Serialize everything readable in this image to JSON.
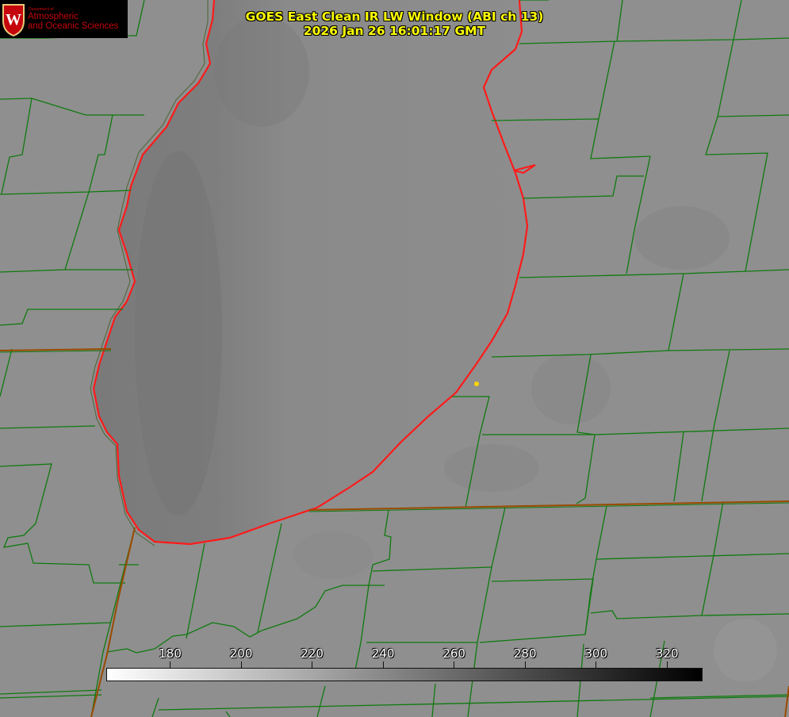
{
  "header": {
    "title_line1": "GOES East Clean IR LW Window (ABI ch 13)",
    "title_line2": "2026 Jan 26 16:01:17 GMT"
  },
  "logo": {
    "dept_label": "Department of",
    "line1": "Atmospheric",
    "line2": "and Oceanic Sciences",
    "crest_letter": "W",
    "icon": "university-crest-icon"
  },
  "colorbar": {
    "ticks": [
      180,
      200,
      220,
      240,
      260,
      280,
      300,
      320
    ],
    "range": [
      162,
      330
    ],
    "gradient_from": "#ffffff",
    "gradient_to": "#000000"
  },
  "colors": {
    "coastline": "#ff1a1a",
    "boundaries": "#0f7a0f",
    "state_line": "#9a4a00",
    "title": "#ffff00",
    "logo_red": "#c5050c",
    "land": "#8f8f8f",
    "lake": "#888888",
    "marker": "#ffd700"
  },
  "map": {
    "feature": "lake-michigan",
    "marker": "city-marker-icon"
  }
}
